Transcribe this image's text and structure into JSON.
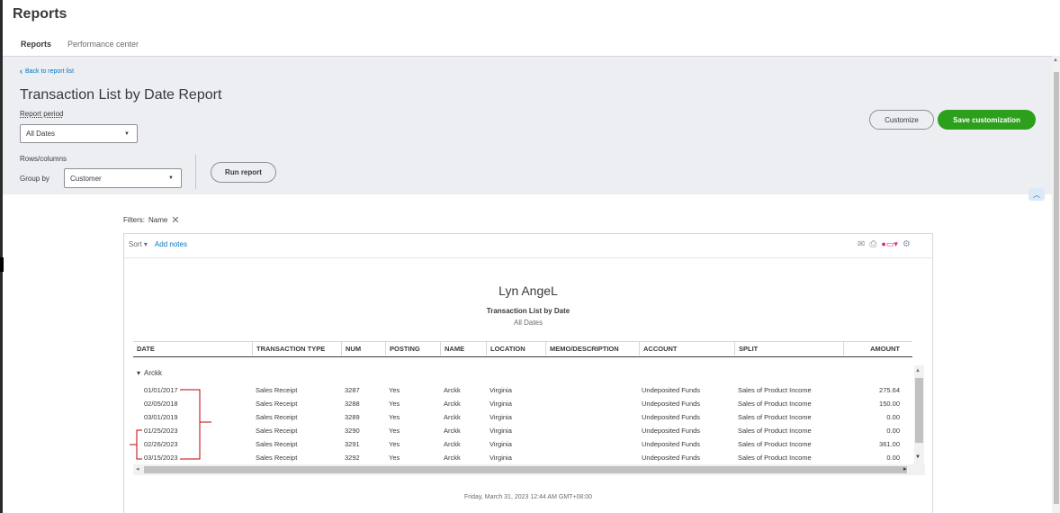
{
  "page": {
    "title": "Reports"
  },
  "tabs": [
    {
      "label": "Reports",
      "active": true
    },
    {
      "label": "Performance center",
      "active": false
    }
  ],
  "header": {
    "back_link": "Back to report list",
    "report_title": "Transaction List by Date Report",
    "period_label": "Report period",
    "period_value": "All Dates",
    "rows_columns_label": "Rows/columns",
    "group_by_label": "Group by",
    "group_by_value": "Customer",
    "run_report": "Run report",
    "customize": "Customize",
    "save_customization": "Save customization"
  },
  "filters": {
    "label": "Filters:",
    "name_chip": "Name"
  },
  "toolbar": {
    "sort": "Sort",
    "add_notes": "Add notes"
  },
  "report": {
    "company": "Lyn AngeL",
    "title": "Transaction List by Date",
    "subtitle": "All Dates",
    "columns": [
      "DATE",
      "TRANSACTION TYPE",
      "NUM",
      "POSTING",
      "NAME",
      "LOCATION",
      "MEMO/DESCRIPTION",
      "ACCOUNT",
      "SPLIT",
      "AMOUNT"
    ],
    "group": "Arckk",
    "rows": [
      [
        "01/01/2017",
        "Sales Receipt",
        "3287",
        "Yes",
        "Arckk",
        "Virginia",
        "",
        "Undeposited Funds",
        "Sales of Product Income",
        "275.64"
      ],
      [
        "02/05/2018",
        "Sales Receipt",
        "3288",
        "Yes",
        "Arckk",
        "Virginia",
        "",
        "Undeposited Funds",
        "Sales of Product Income",
        "150.00"
      ],
      [
        "03/01/2019",
        "Sales Receipt",
        "3289",
        "Yes",
        "Arckk",
        "Virginia",
        "",
        "Undeposited Funds",
        "Sales of Product Income",
        "0.00"
      ],
      [
        "01/25/2023",
        "Sales Receipt",
        "3290",
        "Yes",
        "Arckk",
        "Virginia",
        "",
        "Undeposited Funds",
        "Sales of Product Income",
        "0.00"
      ],
      [
        "02/26/2023",
        "Sales Receipt",
        "3291",
        "Yes",
        "Arckk",
        "Virginia",
        "",
        "Undeposited Funds",
        "Sales of Product Income",
        "361.00"
      ],
      [
        "03/15/2023",
        "Sales Receipt",
        "3292",
        "Yes",
        "Arckk",
        "Virginia",
        "",
        "Undeposited Funds",
        "Sales of Product Income",
        "0.00"
      ]
    ],
    "footer": "Friday, March 31, 2023   12:44 AM GMT+08:00"
  },
  "colors": {
    "accent": "#2ca01c",
    "link": "#0077c5",
    "annotation": "#c00000"
  }
}
